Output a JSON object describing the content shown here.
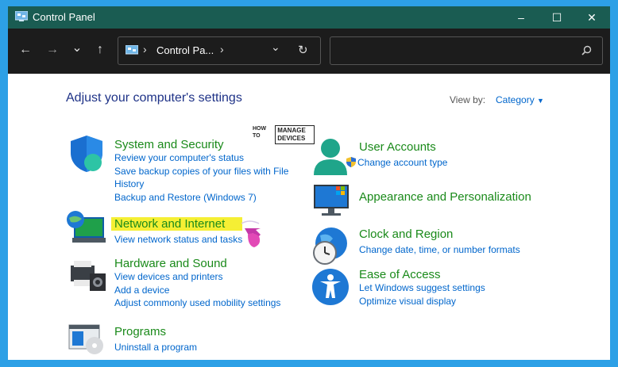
{
  "window": {
    "title": "Control Panel",
    "minimize": "–",
    "maximize": "☐",
    "close": "✕"
  },
  "nav": {
    "back": "←",
    "forward": "→",
    "recent": "⌄",
    "up": "↑",
    "address": "Control Pa...",
    "address_sep1": "›",
    "address_sep2": "›",
    "dropdown": "⌄",
    "refresh": "↻",
    "search_placeholder": ""
  },
  "main": {
    "heading": "Adjust your computer's settings",
    "view_by_label": "View by:",
    "view_by_value": "Category",
    "watermark": [
      "HOW TO",
      "MANAGE DEVICES"
    ]
  },
  "categories_left": [
    {
      "title": "System and Security",
      "links": [
        "Review your computer's status",
        "Save backup copies of your files with File History",
        "Backup and Restore (Windows 7)"
      ]
    },
    {
      "title": "Network and Internet",
      "links": [
        "View network status and tasks"
      ]
    },
    {
      "title": "Hardware and Sound",
      "links": [
        "View devices and printers",
        "Add a device",
        "Adjust commonly used mobility settings"
      ]
    },
    {
      "title": "Programs",
      "links": [
        "Uninstall a program"
      ]
    }
  ],
  "categories_right": [
    {
      "title": "User Accounts",
      "links": [
        "Change account type"
      ]
    },
    {
      "title": "Appearance and Personalization",
      "links": []
    },
    {
      "title": "Clock and Region",
      "links": [
        "Change date, time, or number formats"
      ]
    },
    {
      "title": "Ease of Access",
      "links": [
        "Let Windows suggest settings",
        "Optimize visual display"
      ]
    }
  ],
  "colors": {
    "titlebar": "#1a5c52",
    "navbar": "#1c1c1c",
    "frame": "#2da0e6",
    "category_title": "#1a8a1a",
    "link": "#0066cc",
    "heading": "#1e3287",
    "highlight": "#f5ef34"
  }
}
